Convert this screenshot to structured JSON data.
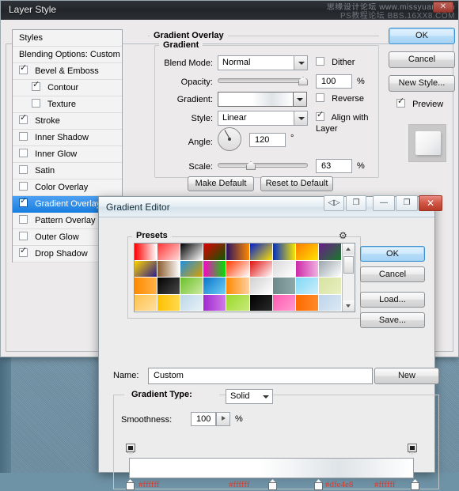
{
  "window": {
    "title": "Layer Style",
    "close_label": "✕",
    "watermark_line1": "思缘设计论坛  www.missyuan.com",
    "watermark_line2": "PS教程论坛  BBS.16XX8.COM"
  },
  "styles_panel": {
    "items": [
      {
        "label": "Styles",
        "type": "header",
        "checked": null,
        "indent": false,
        "selected": false
      },
      {
        "label": "Blending Options: Custom",
        "type": "header",
        "checked": null,
        "indent": false,
        "selected": false
      },
      {
        "label": "Bevel & Emboss",
        "type": "effect",
        "checked": true,
        "indent": false,
        "selected": false
      },
      {
        "label": "Contour",
        "type": "effect",
        "checked": true,
        "indent": true,
        "selected": false
      },
      {
        "label": "Texture",
        "type": "effect",
        "checked": false,
        "indent": true,
        "selected": false
      },
      {
        "label": "Stroke",
        "type": "effect",
        "checked": true,
        "indent": false,
        "selected": false
      },
      {
        "label": "Inner Shadow",
        "type": "effect",
        "checked": false,
        "indent": false,
        "selected": false
      },
      {
        "label": "Inner Glow",
        "type": "effect",
        "checked": false,
        "indent": false,
        "selected": false
      },
      {
        "label": "Satin",
        "type": "effect",
        "checked": false,
        "indent": false,
        "selected": false
      },
      {
        "label": "Color Overlay",
        "type": "effect",
        "checked": false,
        "indent": false,
        "selected": false
      },
      {
        "label": "Gradient Overlay",
        "type": "effect",
        "checked": true,
        "indent": false,
        "selected": true
      },
      {
        "label": "Pattern Overlay",
        "type": "effect",
        "checked": false,
        "indent": false,
        "selected": false
      },
      {
        "label": "Outer Glow",
        "type": "effect",
        "checked": false,
        "indent": false,
        "selected": false
      },
      {
        "label": "Drop Shadow",
        "type": "effect",
        "checked": true,
        "indent": false,
        "selected": false
      }
    ]
  },
  "gradient_overlay": {
    "section_title": "Gradient Overlay",
    "group_title": "Gradient",
    "blend_mode_label": "Blend Mode:",
    "blend_mode_value": "Normal",
    "dither_label": "Dither",
    "dither_checked": false,
    "opacity_label": "Opacity:",
    "opacity_value": "100",
    "opacity_unit": "%",
    "gradient_label": "Gradient:",
    "reverse_label": "Reverse",
    "reverse_checked": false,
    "style_label": "Style:",
    "style_value": "Linear",
    "align_label": "Align with Layer",
    "align_checked": true,
    "angle_label": "Angle:",
    "angle_value": "120",
    "angle_unit": "°",
    "scale_label": "Scale:",
    "scale_value": "63",
    "scale_unit": "%",
    "make_default_label": "Make Default",
    "reset_default_label": "Reset to Default"
  },
  "layer_style_buttons": {
    "ok": "OK",
    "cancel": "Cancel",
    "new_style": "New Style...",
    "preview_label": "Preview",
    "preview_checked": true
  },
  "gradient_editor": {
    "title": "Gradient Editor",
    "titlebar_buttons": {
      "prev_next": "◁▷",
      "restore_small": "❐",
      "minimize": "—",
      "maximize": "❐",
      "close": "✕"
    },
    "presets_label": "Presets",
    "gear_icon": "⚙",
    "buttons": {
      "ok": "OK",
      "cancel": "Cancel",
      "load": "Load...",
      "save": "Save...",
      "new": "New"
    },
    "name_label": "Name:",
    "name_value": "Custom",
    "gradient_type_label": "Gradient Type:",
    "gradient_type_value": "Solid",
    "smoothness_label": "Smoothness:",
    "smoothness_value": "100",
    "smoothness_unit": "%",
    "stop_hex_labels": [
      "#ffffff",
      "#ffffff",
      "#dfe4e8",
      "#ffffff"
    ],
    "presets": [
      [
        "#ff0000",
        "#ffffff"
      ],
      [
        "#ff3333",
        "#ffd9d9"
      ],
      [
        "#000000",
        "#ffffff"
      ],
      [
        "#e00000",
        "#0a5a00"
      ],
      [
        "#2b1060",
        "#ff8a00"
      ],
      [
        "#0020d0",
        "#ffe000"
      ],
      [
        "#0030c8",
        "#f7e400"
      ],
      [
        "#ff7a00",
        "#ffe400"
      ],
      [
        "#6a1a8a",
        "#1a7a2a"
      ],
      [
        "#ffd400",
        "#2b1a8a"
      ],
      [
        "#8a5a2a",
        "#ffffff"
      ],
      [
        "#1f8fe0",
        "#d8a000"
      ],
      [
        "#ff00c8",
        "#00e000"
      ],
      [
        "#ff3a00",
        "#ffffff"
      ],
      [
        "#e01010",
        "#ffffff"
      ],
      [
        "#d9d9d9",
        "#ffffff"
      ],
      [
        "#cc2aa8",
        "#f0b0e0"
      ],
      [
        "#9aa6ad",
        "#ffffff"
      ],
      [
        "#ff8a00",
        "#ffb347"
      ],
      [
        "#000000",
        "#4a4a4a"
      ],
      [
        "#6abf2a",
        "#cdeaa0"
      ],
      [
        "#0a74c8",
        "#6fd0f5"
      ],
      [
        "#ff8a00",
        "#ffd0a0"
      ],
      [
        "#d0d0d0",
        "#ffffff"
      ],
      [
        "#6d8a8a",
        "#8fa8a8"
      ],
      [
        "#7fd8f5",
        "#cdeefb"
      ],
      [
        "#d6e2a0",
        "#e8f0c0"
      ],
      [
        "#ffc14d",
        "#ffe0a0"
      ],
      [
        "#ffc000",
        "#ffd94d"
      ],
      [
        "#bcd6e8",
        "#e8f2f8"
      ],
      [
        "#a02ad0",
        "#cf7ae8"
      ],
      [
        "#9ad92a",
        "#c8ea7a"
      ],
      [
        "#000000",
        "#2a2a2a"
      ],
      [
        "#ff5ab0",
        "#ff9ad0"
      ],
      [
        "#ff6a00",
        "#ff8a2a"
      ],
      [
        "#bcd4ea",
        "#dde9f4"
      ]
    ]
  }
}
